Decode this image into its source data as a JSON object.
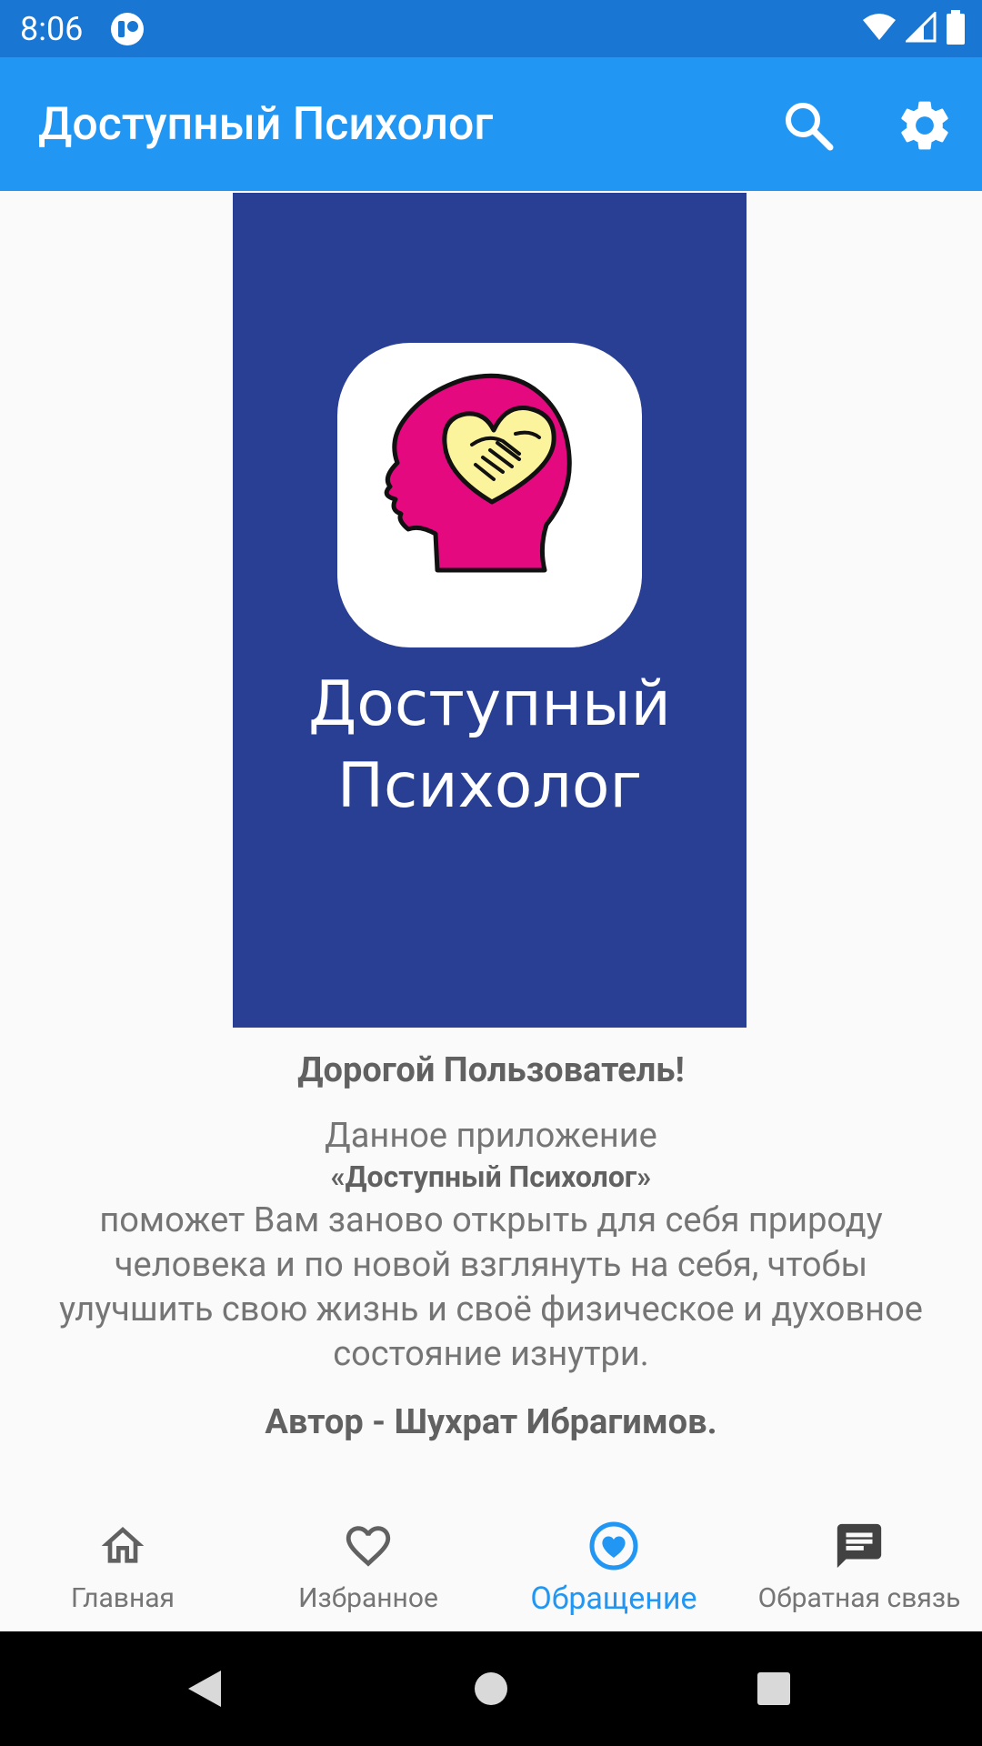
{
  "status_bar": {
    "time": "8:06",
    "icons": [
      "app-notification-icon",
      "wifi-icon",
      "signal-icon",
      "battery-icon"
    ]
  },
  "app_bar": {
    "title": "Доступный Психолог",
    "actions": [
      "search-icon",
      "settings-icon"
    ]
  },
  "poster": {
    "title_line1": "Доступный",
    "title_line2": "Психолог",
    "background": "#293F93"
  },
  "main": {
    "greeting": "Дорогой Пользователь!",
    "intro": "Данное приложение",
    "app_name": "«Доступный Психолог»",
    "body": "поможет Вам заново открыть для себя природу человека и по новой взглянуть на себя, чтобы улучшить свою жизнь и своё физическое и духовное состояние изнутри.",
    "author": "Автор - Шухрат Ибрагимов."
  },
  "bottom_nav": {
    "items": [
      {
        "label": "Главная",
        "icon": "home-icon"
      },
      {
        "label": "Избранное",
        "icon": "heart-outline-icon"
      },
      {
        "label": "Обращение",
        "icon": "heart-circle-icon"
      },
      {
        "label": "Обратная связь",
        "icon": "chat-icon"
      }
    ]
  },
  "colors": {
    "status_bar": "#1976D2",
    "app_bar": "#2196F3",
    "accent": "#2196F3",
    "logo_pink": "#E5097F",
    "logo_yellow": "#FBF49C"
  }
}
